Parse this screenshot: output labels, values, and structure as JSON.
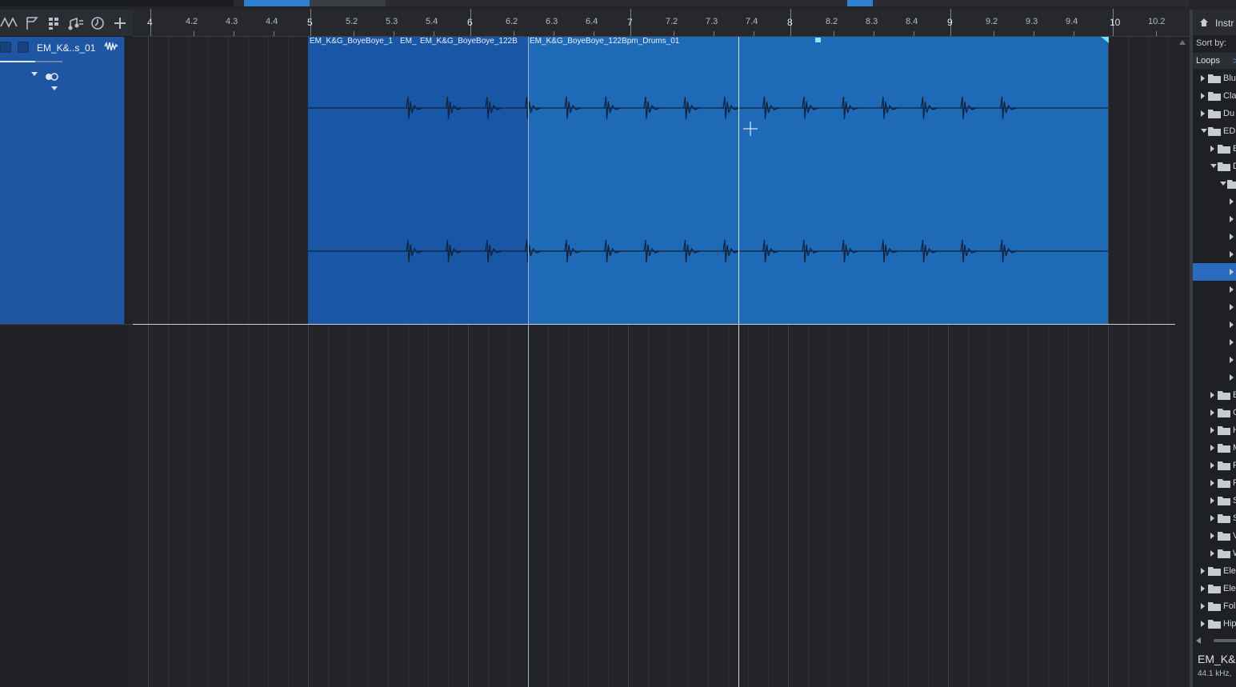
{
  "ruler": {
    "ticks": [
      {
        "label": "4",
        "major": true
      },
      {
        "label": "4.2",
        "major": false
      },
      {
        "label": "4.3",
        "major": false
      },
      {
        "label": "4.4",
        "major": false
      },
      {
        "label": "5",
        "major": true
      },
      {
        "label": "5.2",
        "major": false
      },
      {
        "label": "5.3",
        "major": false
      },
      {
        "label": "5.4",
        "major": false
      },
      {
        "label": "6",
        "major": true
      },
      {
        "label": "6.2",
        "major": false
      },
      {
        "label": "6.3",
        "major": false
      },
      {
        "label": "6.4",
        "major": false
      },
      {
        "label": "7",
        "major": true
      },
      {
        "label": "7.2",
        "major": false
      },
      {
        "label": "7.3",
        "major": false
      },
      {
        "label": "7.4",
        "major": false
      },
      {
        "label": "8",
        "major": true
      },
      {
        "label": "8.2",
        "major": false
      },
      {
        "label": "8.3",
        "major": false
      },
      {
        "label": "8.4",
        "major": false
      },
      {
        "label": "9",
        "major": true
      },
      {
        "label": "9.2",
        "major": false
      },
      {
        "label": "9.3",
        "major": false
      },
      {
        "label": "9.4",
        "major": false
      },
      {
        "label": "10",
        "major": true
      },
      {
        "label": "10.2",
        "major": false
      }
    ]
  },
  "track": {
    "name": "EM_K&..s_01"
  },
  "clips": {
    "clip1_title": "EM_K&G_BoyeBoye_1",
    "clip2_title": "EM_",
    "clip3_title": "EM_K&G_BoyeBoye_122B",
    "clip4_title": "EM_K&G_BoyeBoye_122Bpm_Drums_01"
  },
  "browser": {
    "header_label": "Instr",
    "sort_label": "Sort by:",
    "loops_tab": "Loops",
    "loops_arrow": ">",
    "tree": [
      {
        "label": "Blu",
        "level": 0,
        "expanded": false,
        "folder": true
      },
      {
        "label": "Cla",
        "level": 0,
        "expanded": false,
        "folder": true
      },
      {
        "label": "Du",
        "level": 0,
        "expanded": false,
        "folder": true
      },
      {
        "label": "ED",
        "level": 0,
        "expanded": true,
        "folder": true
      },
      {
        "label": "E",
        "level": 1,
        "expanded": false,
        "folder": true
      },
      {
        "label": "D",
        "level": 1,
        "expanded": true,
        "folder": true
      },
      {
        "label": "",
        "level": 2,
        "expanded": true,
        "folder": true
      },
      {
        "label": "",
        "level": 3,
        "expanded": false,
        "folder": false
      },
      {
        "label": "",
        "level": 3,
        "expanded": false,
        "folder": false
      },
      {
        "label": "",
        "level": 3,
        "expanded": false,
        "folder": false
      },
      {
        "label": "",
        "level": 3,
        "expanded": false,
        "folder": false
      },
      {
        "label": "",
        "level": 3,
        "expanded": false,
        "folder": false,
        "selected": true
      },
      {
        "label": "",
        "level": 3,
        "expanded": false,
        "folder": false
      },
      {
        "label": "",
        "level": 3,
        "expanded": false,
        "folder": false
      },
      {
        "label": "",
        "level": 3,
        "expanded": false,
        "folder": false
      },
      {
        "label": "",
        "level": 3,
        "expanded": false,
        "folder": false
      },
      {
        "label": "",
        "level": 3,
        "expanded": false,
        "folder": false
      },
      {
        "label": "",
        "level": 3,
        "expanded": false,
        "folder": false
      },
      {
        "label": "B",
        "level": 1,
        "expanded": false,
        "folder": true
      },
      {
        "label": "C",
        "level": 1,
        "expanded": false,
        "folder": true
      },
      {
        "label": "H",
        "level": 1,
        "expanded": false,
        "folder": true
      },
      {
        "label": "M",
        "level": 1,
        "expanded": false,
        "folder": true
      },
      {
        "label": "P",
        "level": 1,
        "expanded": false,
        "folder": true
      },
      {
        "label": "R",
        "level": 1,
        "expanded": false,
        "folder": true
      },
      {
        "label": "S",
        "level": 1,
        "expanded": false,
        "folder": true
      },
      {
        "label": "S",
        "level": 1,
        "expanded": false,
        "folder": true
      },
      {
        "label": "V",
        "level": 1,
        "expanded": false,
        "folder": true
      },
      {
        "label": "W",
        "level": 1,
        "expanded": false,
        "folder": true
      },
      {
        "label": "Ele",
        "level": 0,
        "expanded": false,
        "folder": true
      },
      {
        "label": "Ele",
        "level": 0,
        "expanded": false,
        "folder": true
      },
      {
        "label": "Fol",
        "level": 0,
        "expanded": false,
        "folder": true
      },
      {
        "label": "Hip",
        "level": 0,
        "expanded": false,
        "folder": true
      }
    ],
    "file_name": "EM_K&",
    "file_info": "44.1 kHz,"
  },
  "colors": {
    "clip_dark": "#1a56a6",
    "clip_light": "#1e6ab7",
    "selection": "#2a6bc0",
    "accent": "#3d8fe0"
  }
}
